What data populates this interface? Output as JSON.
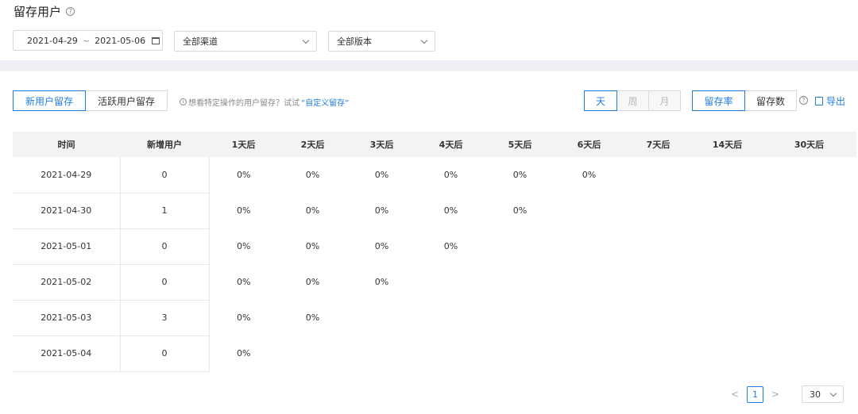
{
  "header": {
    "title": "留存用户",
    "help_icon": "?"
  },
  "filters": {
    "date_start": "2021-04-29",
    "date_sep": "~",
    "date_end": "2021-05-06",
    "channel": "全部渠道",
    "version": "全部版本"
  },
  "tabs": {
    "new_users": "新用户留存",
    "active_users": "活跃用户留存",
    "active": "new_users"
  },
  "hint": {
    "info": "i",
    "text": "想看特定操作的用户留存？试试",
    "link": "“自定义留存”"
  },
  "granularity": {
    "day": "天",
    "week": "周",
    "month": "月",
    "active": "day"
  },
  "metric": {
    "rate": "留存率",
    "count": "留存数",
    "active": "rate"
  },
  "metric_help": "?",
  "export_label": "导出",
  "table": {
    "columns": [
      "时间",
      "新增用户",
      "1天后",
      "2天后",
      "3天后",
      "4天后",
      "5天后",
      "6天后",
      "7天后",
      "14天后",
      "30天后"
    ],
    "rows": [
      {
        "date": "2021-04-29",
        "new": "0",
        "cells": [
          "0%",
          "0%",
          "0%",
          "0%",
          "0%",
          "0%",
          "",
          "",
          ""
        ]
      },
      {
        "date": "2021-04-30",
        "new": "1",
        "cells": [
          "0%",
          "0%",
          "0%",
          "0%",
          "0%",
          "",
          "",
          "",
          ""
        ]
      },
      {
        "date": "2021-05-01",
        "new": "0",
        "cells": [
          "0%",
          "0%",
          "0%",
          "0%",
          "",
          "",
          "",
          "",
          ""
        ]
      },
      {
        "date": "2021-05-02",
        "new": "0",
        "cells": [
          "0%",
          "0%",
          "0%",
          "",
          "",
          "",
          "",
          "",
          ""
        ]
      },
      {
        "date": "2021-05-03",
        "new": "3",
        "cells": [
          "0%",
          "0%",
          "",
          "",
          "",
          "",
          "",
          "",
          ""
        ]
      },
      {
        "date": "2021-05-04",
        "new": "0",
        "cells": [
          "0%",
          "",
          "",
          "",
          "",
          "",
          "",
          "",
          ""
        ]
      }
    ]
  },
  "pagination": {
    "prev": "<",
    "page": "1",
    "next": ">",
    "page_size": "30"
  },
  "colors": {
    "accent": "#1f7de0",
    "band": "#eff0f5",
    "header_bg": "#f2f3f5"
  }
}
